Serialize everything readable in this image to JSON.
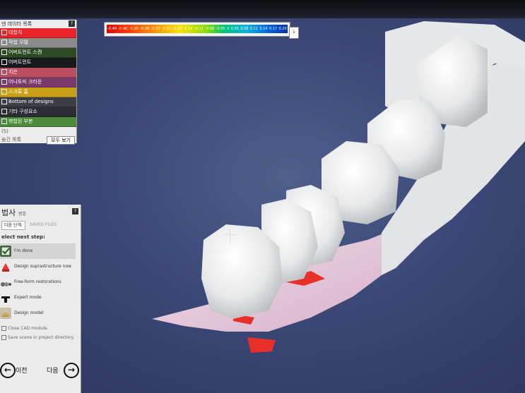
{
  "colors": {
    "viewport_bg": "#3b4877",
    "tooth": "#f2f2f2",
    "gingiva": "#e4c6da",
    "margin_red": "#e8302a"
  },
  "scale": {
    "ticks": [
      "-0.40",
      "-0.40",
      "-0.28",
      "-0.26",
      "-0.23",
      "-0.20",
      "-0.17",
      "-0.14",
      "-0.11",
      "-0.08",
      "-0.05",
      "0",
      "0.05",
      "0.08",
      "0.11",
      "0.14",
      "0.17",
      "0.20"
    ],
    "arrow": "›"
  },
  "layers": {
    "header": "덴 데이터 목록",
    "help": "?",
    "items": [
      {
        "label": "대합치",
        "color": "#e8242a"
      },
      {
        "label": "작업 모델",
        "color": "#8a8a8a"
      },
      {
        "label": "어버트먼트 스캔",
        "color": "#2d4a24"
      },
      {
        "label": "어버트먼트",
        "color": "#17191c"
      },
      {
        "label": "치은",
        "color": "#b94f61"
      },
      {
        "label": "어나토미 크라운",
        "color": "#7c3a6a"
      },
      {
        "label": "스크류 홈",
        "color": "#c8a018"
      },
      {
        "label": "Bottom of designs",
        "color": "#3b3e44"
      },
      {
        "label": "기타 구성요소",
        "color": "#2a2d33"
      },
      {
        "label": "병합된 부분",
        "color": "#4a8a3a"
      }
    ],
    "extra_label": "(S)",
    "footer_label": "숨긴 목록",
    "show_all": "모두 보기"
  },
  "wizard": {
    "title": "법사",
    "subtitle": "병합",
    "help": "?",
    "tab_active": "다음 단계:",
    "tab_other": "SAVED FILES",
    "select_label": "elect next step:",
    "steps": [
      {
        "label": "I'm done",
        "icon": "check-icon"
      },
      {
        "label": "Design suprastructure now",
        "icon": "crown-icon"
      },
      {
        "label": "Free-form restorations",
        "icon": "freeform-icon"
      },
      {
        "label": "Expert mode",
        "icon": "expert-icon"
      },
      {
        "label": "Design model",
        "icon": "model-icon"
      }
    ],
    "close_cad": "Close CAD module.",
    "save_scene": "Save scene in project directory.",
    "back": "이전",
    "next": "다음"
  }
}
